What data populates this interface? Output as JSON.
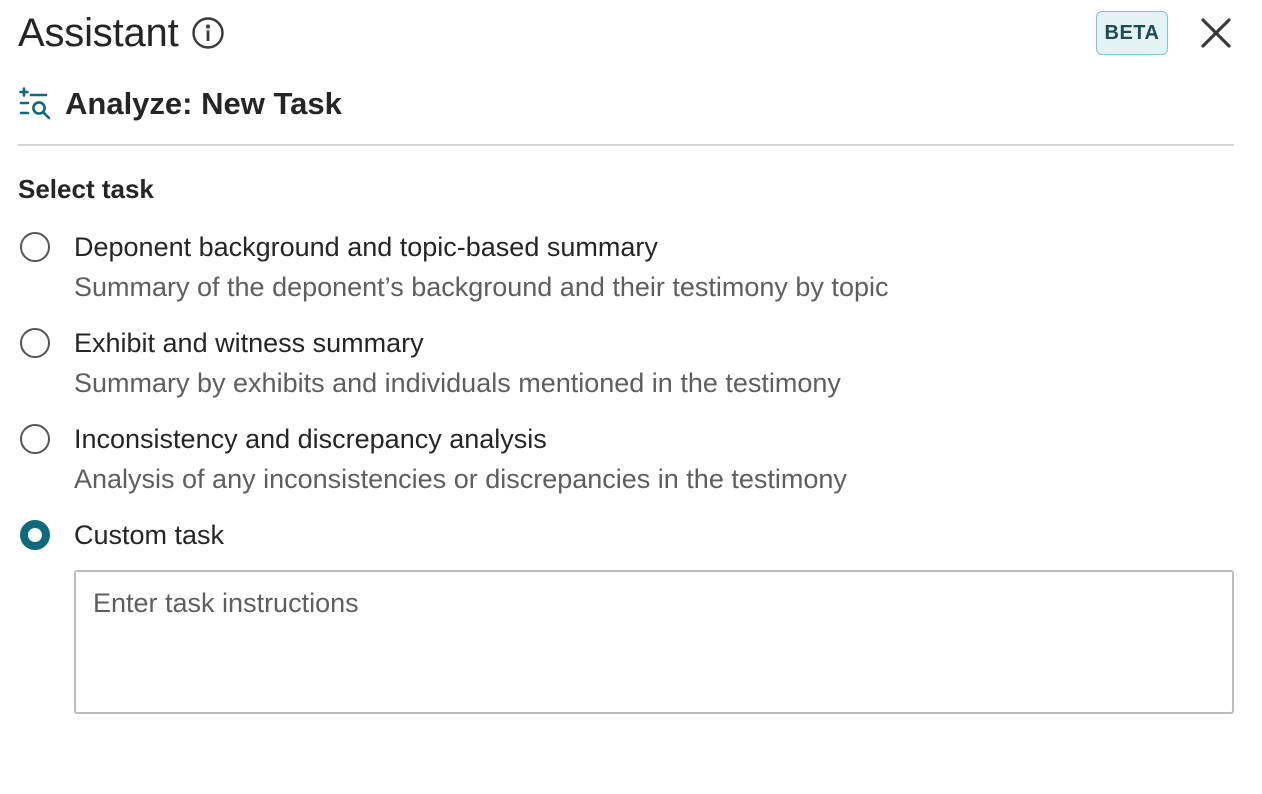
{
  "header": {
    "title": "Assistant",
    "badge": "BETA",
    "info_icon": "info-circle-icon",
    "close_icon": "close-icon"
  },
  "subheader": {
    "icon": "analyze-list-search-icon",
    "title": "Analyze: New Task"
  },
  "task_select": {
    "label": "Select task",
    "selected_index": 3,
    "options": [
      {
        "title": "Deponent background and topic-based summary",
        "description": "Summary of the deponent’s background and their testimony by topic",
        "checked": false
      },
      {
        "title": "Exhibit and witness summary",
        "description": "Summary by exhibits and individuals mentioned in the testimony",
        "checked": false
      },
      {
        "title": "Inconsistency and discrepancy analysis",
        "description": "Analysis of any inconsistencies or discrepancies in the testimony",
        "checked": false
      },
      {
        "title": "Custom task",
        "description": "",
        "checked": true
      }
    ]
  },
  "custom_task_input": {
    "value": "",
    "placeholder": "Enter task instructions"
  },
  "colors": {
    "accent": "#0d6a7a",
    "badge_bg": "#e3f2f4",
    "badge_border": "#7fc6cf",
    "badge_text": "#1d4a53",
    "text_primary": "#252525",
    "text_secondary": "#5e5e5e",
    "divider": "#d6d6d6"
  }
}
